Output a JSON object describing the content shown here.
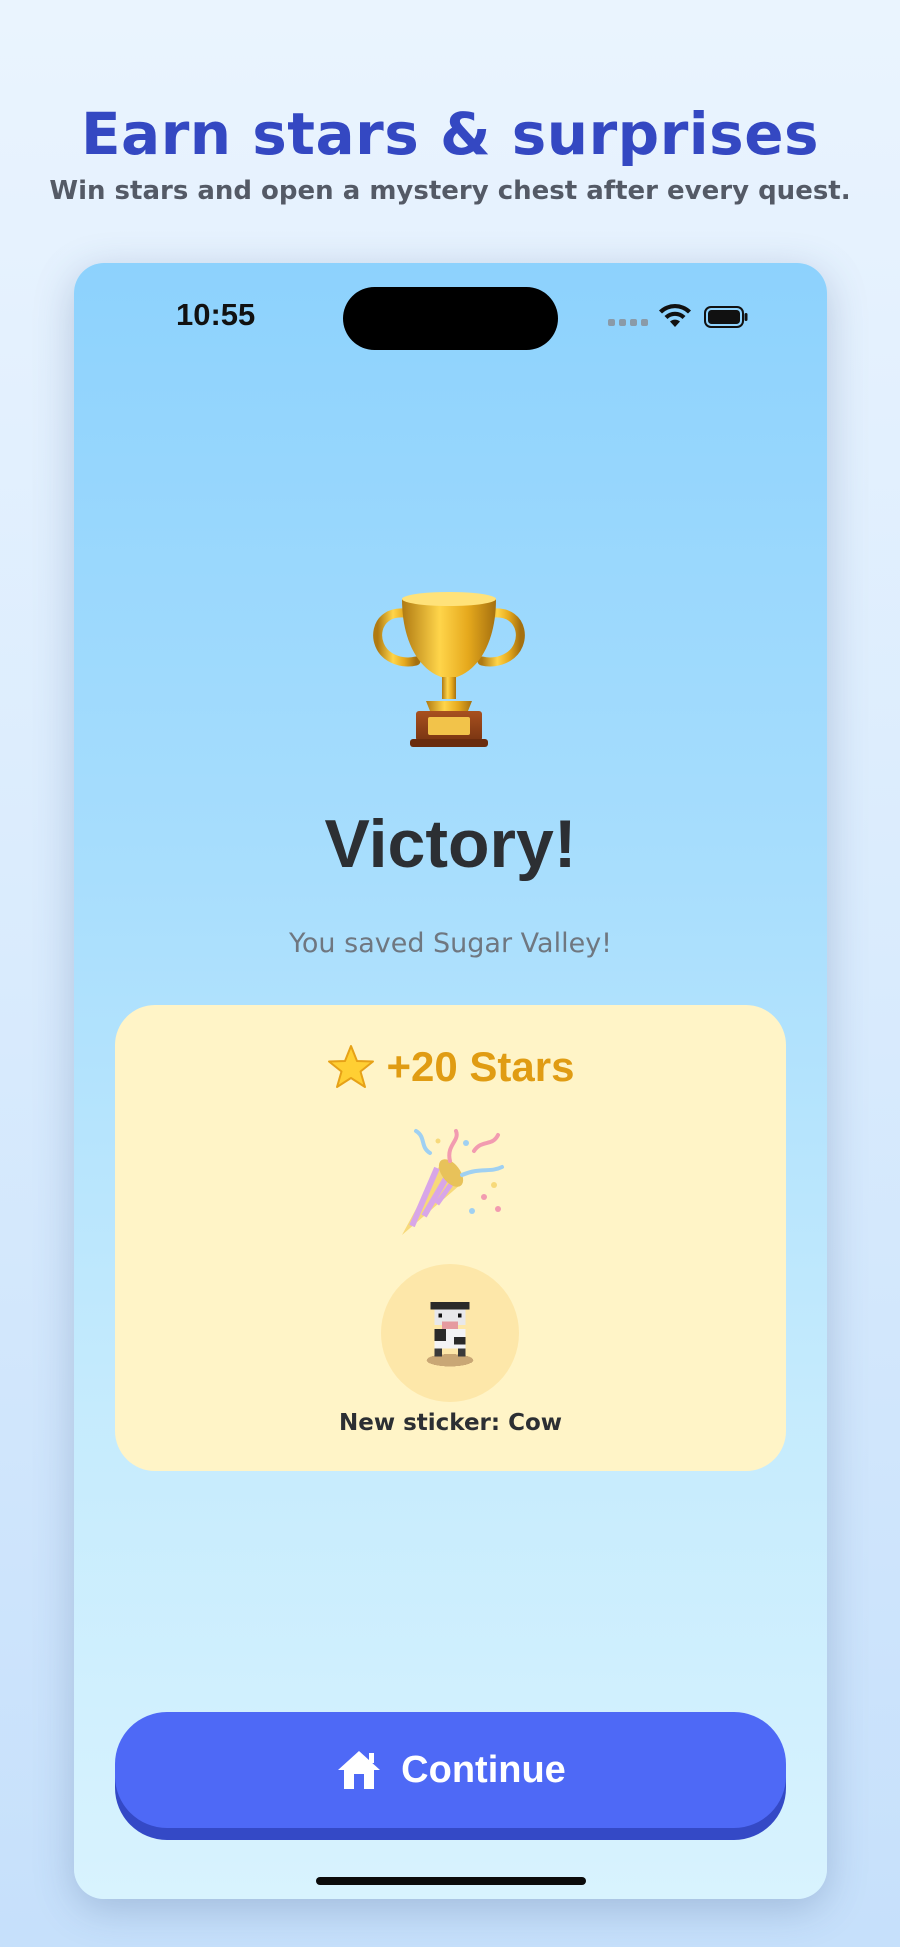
{
  "promo": {
    "headline": "Earn stars & surprises",
    "subhead": "Win stars and open a mystery chest after every quest."
  },
  "status_bar": {
    "time": "10:55",
    "icons": [
      "signal-dots-icon",
      "wifi-icon",
      "battery-icon"
    ]
  },
  "victory": {
    "trophy_icon": "trophy-icon",
    "title": "Victory!",
    "subtitle": "You saved Sugar Valley!"
  },
  "reward": {
    "star_icon": "star-icon",
    "stars_label": "+20 Stars",
    "celebration_icon": "party-popper-icon",
    "sticker_icon": "cow-icon",
    "sticker_label": "New sticker: Cow"
  },
  "actions": {
    "continue_icon": "home-icon",
    "continue_label": "Continue"
  },
  "colors": {
    "headline": "#3448c2",
    "reward_card": "#fff4c7",
    "stars_text": "#e09c13",
    "button": "#4e69f6"
  }
}
